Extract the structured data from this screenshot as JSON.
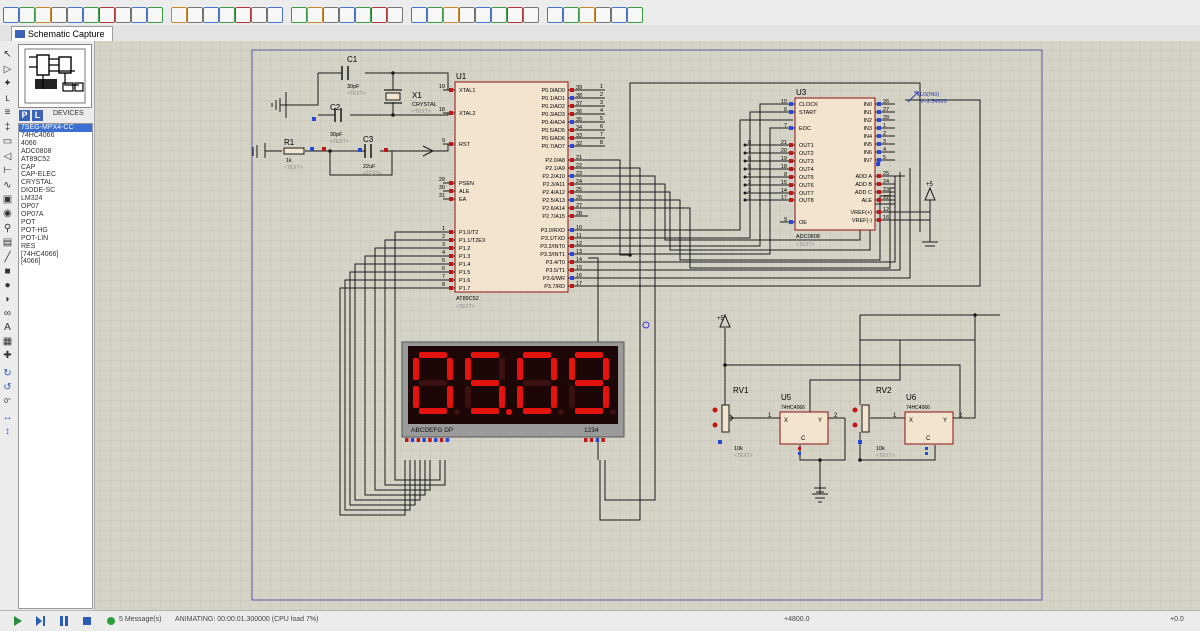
{
  "tab": {
    "title": "Schematic Capture"
  },
  "devices": {
    "header": "DEVICES",
    "p_label": "P",
    "l_label": "L",
    "items": [
      "7SEG-MPX4-CC",
      "74HC4066",
      "4066",
      "ADC0808",
      "AT89C52",
      "CAP",
      "CAP-ELEC",
      "CRYSTAL",
      "DIODE-SC",
      "LM324",
      "OP07",
      "OP07A",
      "POT",
      "POT-HG",
      "POT-LIN",
      "RES",
      "[74HC4066]",
      "[4066]"
    ],
    "selected_index": 0
  },
  "left_tools": {
    "rotate_value": "0°"
  },
  "status": {
    "messages": "5 Message(s)",
    "animating": "ANIMATING: 00:00:01.300000 (CPU load 7%)",
    "coord_x": "+4800.0",
    "coord_y": "+0.0"
  },
  "schematic": {
    "u1": {
      "ref": "U1",
      "part": "AT89C52",
      "text": "<TEXT>",
      "left_pins": [
        {
          "num": "19",
          "name": "XTAL1"
        },
        {
          "num": "18",
          "name": "XTAL2"
        },
        {
          "num": "9",
          "name": "RST"
        },
        {
          "num": "29",
          "name": "PSEN"
        },
        {
          "num": "30",
          "name": "ALE"
        },
        {
          "num": "31",
          "name": "EA"
        },
        {
          "num": "1",
          "name": "P1.0/T2"
        },
        {
          "num": "2",
          "name": "P1.1/T2EX"
        },
        {
          "num": "3",
          "name": "P1.2"
        },
        {
          "num": "4",
          "name": "P1.3"
        },
        {
          "num": "5",
          "name": "P1.4"
        },
        {
          "num": "6",
          "name": "P1.5"
        },
        {
          "num": "7",
          "name": "P1.6"
        },
        {
          "num": "8",
          "name": "P1.7"
        }
      ],
      "right_pins": [
        {
          "num": "39",
          "name": "P0.0/AD0"
        },
        {
          "num": "38",
          "name": "P0.1/AD1"
        },
        {
          "num": "37",
          "name": "P0.2/AD2"
        },
        {
          "num": "36",
          "name": "P0.3/AD3"
        },
        {
          "num": "35",
          "name": "P0.4/AD4"
        },
        {
          "num": "34",
          "name": "P0.5/AD5"
        },
        {
          "num": "33",
          "name": "P0.6/AD6"
        },
        {
          "num": "32",
          "name": "P0.7/AD7"
        },
        {
          "num": "21",
          "name": "P2.0/A8"
        },
        {
          "num": "22",
          "name": "P2.1/A9"
        },
        {
          "num": "23",
          "name": "P2.2/A10"
        },
        {
          "num": "24",
          "name": "P2.3/A11"
        },
        {
          "num": "25",
          "name": "P2.4/A12"
        },
        {
          "num": "26",
          "name": "P2.5/A13"
        },
        {
          "num": "27",
          "name": "P2.6/A14"
        },
        {
          "num": "28",
          "name": "P2.7/A15"
        },
        {
          "num": "10",
          "name": "P3.0/RXD"
        },
        {
          "num": "11",
          "name": "P3.1/TXD"
        },
        {
          "num": "12",
          "name": "P3.2/INT0"
        },
        {
          "num": "13",
          "name": "P3.3/INT1"
        },
        {
          "num": "14",
          "name": "P3.4/T0"
        },
        {
          "num": "15",
          "name": "P3.5/T1"
        },
        {
          "num": "16",
          "name": "P3.6/WR"
        },
        {
          "num": "17",
          "name": "P3.7/RD"
        }
      ],
      "p0_nets": [
        "1",
        "2",
        "3",
        "4",
        "5",
        "6",
        "7",
        "8"
      ]
    },
    "u3": {
      "ref": "U3",
      "part": "ADC0808",
      "text": "<TEXT>",
      "left_pins": [
        {
          "num": "10",
          "name": "CLOCK"
        },
        {
          "num": "6",
          "name": "START"
        },
        {
          "num": "7",
          "name": "EOC"
        },
        {
          "num": "21",
          "name": "OUT1"
        },
        {
          "num": "20",
          "name": "OUT2"
        },
        {
          "num": "19",
          "name": "OUT3"
        },
        {
          "num": "18",
          "name": "OUT4"
        },
        {
          "num": "8",
          "name": "OUT5"
        },
        {
          "num": "15",
          "name": "OUT6"
        },
        {
          "num": "14",
          "name": "OUT7"
        },
        {
          "num": "17",
          "name": "OUT8"
        },
        {
          "num": "9",
          "name": "OE"
        }
      ],
      "right_pins": [
        {
          "num": "26",
          "name": "IN0"
        },
        {
          "num": "27",
          "name": "IN1"
        },
        {
          "num": "28",
          "name": "IN2"
        },
        {
          "num": "1",
          "name": "IN3"
        },
        {
          "num": "2",
          "name": "IN4"
        },
        {
          "num": "3",
          "name": "IN5"
        },
        {
          "num": "4",
          "name": "IN6"
        },
        {
          "num": "5",
          "name": "IN7"
        },
        {
          "num": "25",
          "name": "ADD A"
        },
        {
          "num": "24",
          "name": "ADD B"
        },
        {
          "num": "23",
          "name": "ADD C"
        },
        {
          "num": "22",
          "name": "ALE"
        },
        {
          "num": "12",
          "name": "VREF(+)"
        },
        {
          "num": "16",
          "name": "VREF(-)"
        }
      ],
      "out_nets": [
        "8",
        "7",
        "6",
        "5",
        "4",
        "3",
        "2",
        "1"
      ],
      "probe": "U3(IN0)",
      "probe_value": "V=2.54999",
      "vcc": "+5"
    },
    "c1": {
      "ref": "C1",
      "value": "30pF",
      "text": "<TEXT>"
    },
    "c2": {
      "ref": "C2",
      "value": "30pF",
      "text": "<TEXT>"
    },
    "c3": {
      "ref": "C3",
      "value": "22uF",
      "text": "<TEXT>"
    },
    "x1": {
      "ref": "X1",
      "value": "CRYSTAL",
      "text": "<TEXT>"
    },
    "r1": {
      "ref": "R1",
      "value": "1k",
      "text": "<TEXT>"
    },
    "display": {
      "digits": "0509",
      "seg_label": "ABCDEFG DP",
      "digit_label": "1234"
    },
    "rv1": {
      "ref": "RV1",
      "value": "10k",
      "text": "<TEXT>",
      "vcc": "+5"
    },
    "rv2": {
      "ref": "RV2",
      "value": "10k",
      "text": "<TEXT>"
    },
    "u5": {
      "ref": "U5",
      "part": "74HC4066",
      "pin_x": "X",
      "pin_y": "Y",
      "pin_c": "C",
      "pin_1": "1",
      "pin_2": "2"
    },
    "u6": {
      "ref": "U6",
      "part": "74HC4066",
      "pin_x": "X",
      "pin_y": "Y",
      "pin_c": "C",
      "pin_1": "1",
      "pin_2": "2"
    }
  },
  "colors": {
    "component_fill": "#f2e4cf",
    "component_border": "#8b1010",
    "wire": "#1a1a1a",
    "grid_bg": "#d5d3c6",
    "seg_on": "#e3130f",
    "seg_off": "#3a1010"
  }
}
